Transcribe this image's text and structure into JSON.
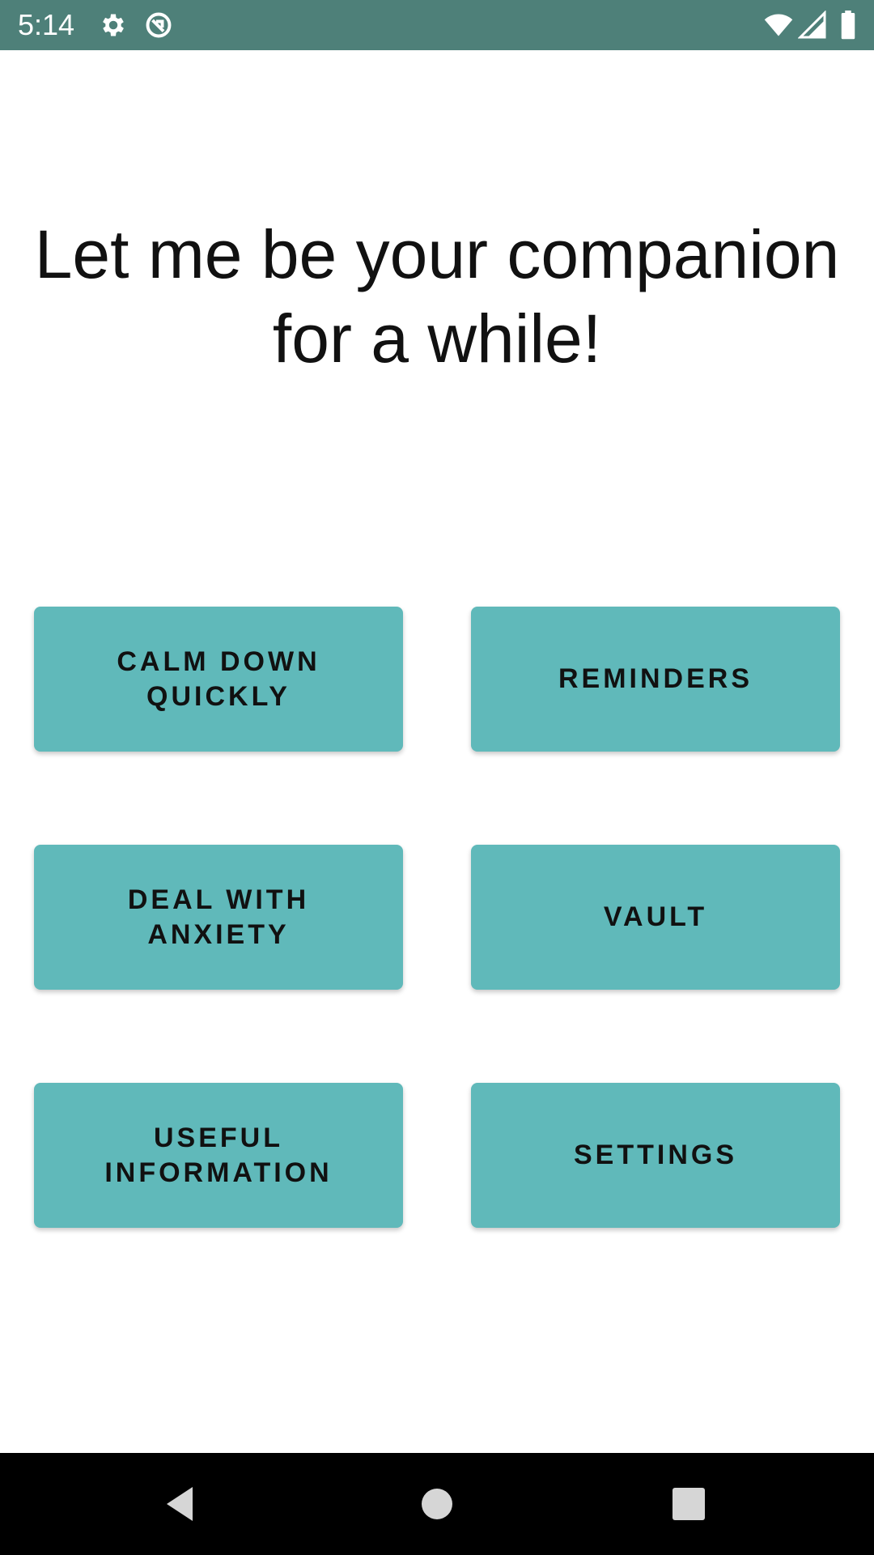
{
  "status_bar": {
    "time": "5:14",
    "icons": [
      "gear-icon",
      "sync-disabled-icon",
      "wifi-icon",
      "signal-icon",
      "battery-icon"
    ],
    "background_color": "#4e8079"
  },
  "main": {
    "headline": "Let me be your companion for a while!"
  },
  "menu": {
    "button_color": "#60b9ba",
    "buttons": [
      {
        "label": "CALM DOWN\nQUICKLY"
      },
      {
        "label": "REMINDERS"
      },
      {
        "label": "DEAL WITH\nANXIETY"
      },
      {
        "label": "VAULT"
      },
      {
        "label": "USEFUL\nINFORMATION"
      },
      {
        "label": "SETTINGS"
      }
    ]
  },
  "nav_bar": {
    "icons": [
      "back-icon",
      "home-icon",
      "recents-icon"
    ]
  }
}
